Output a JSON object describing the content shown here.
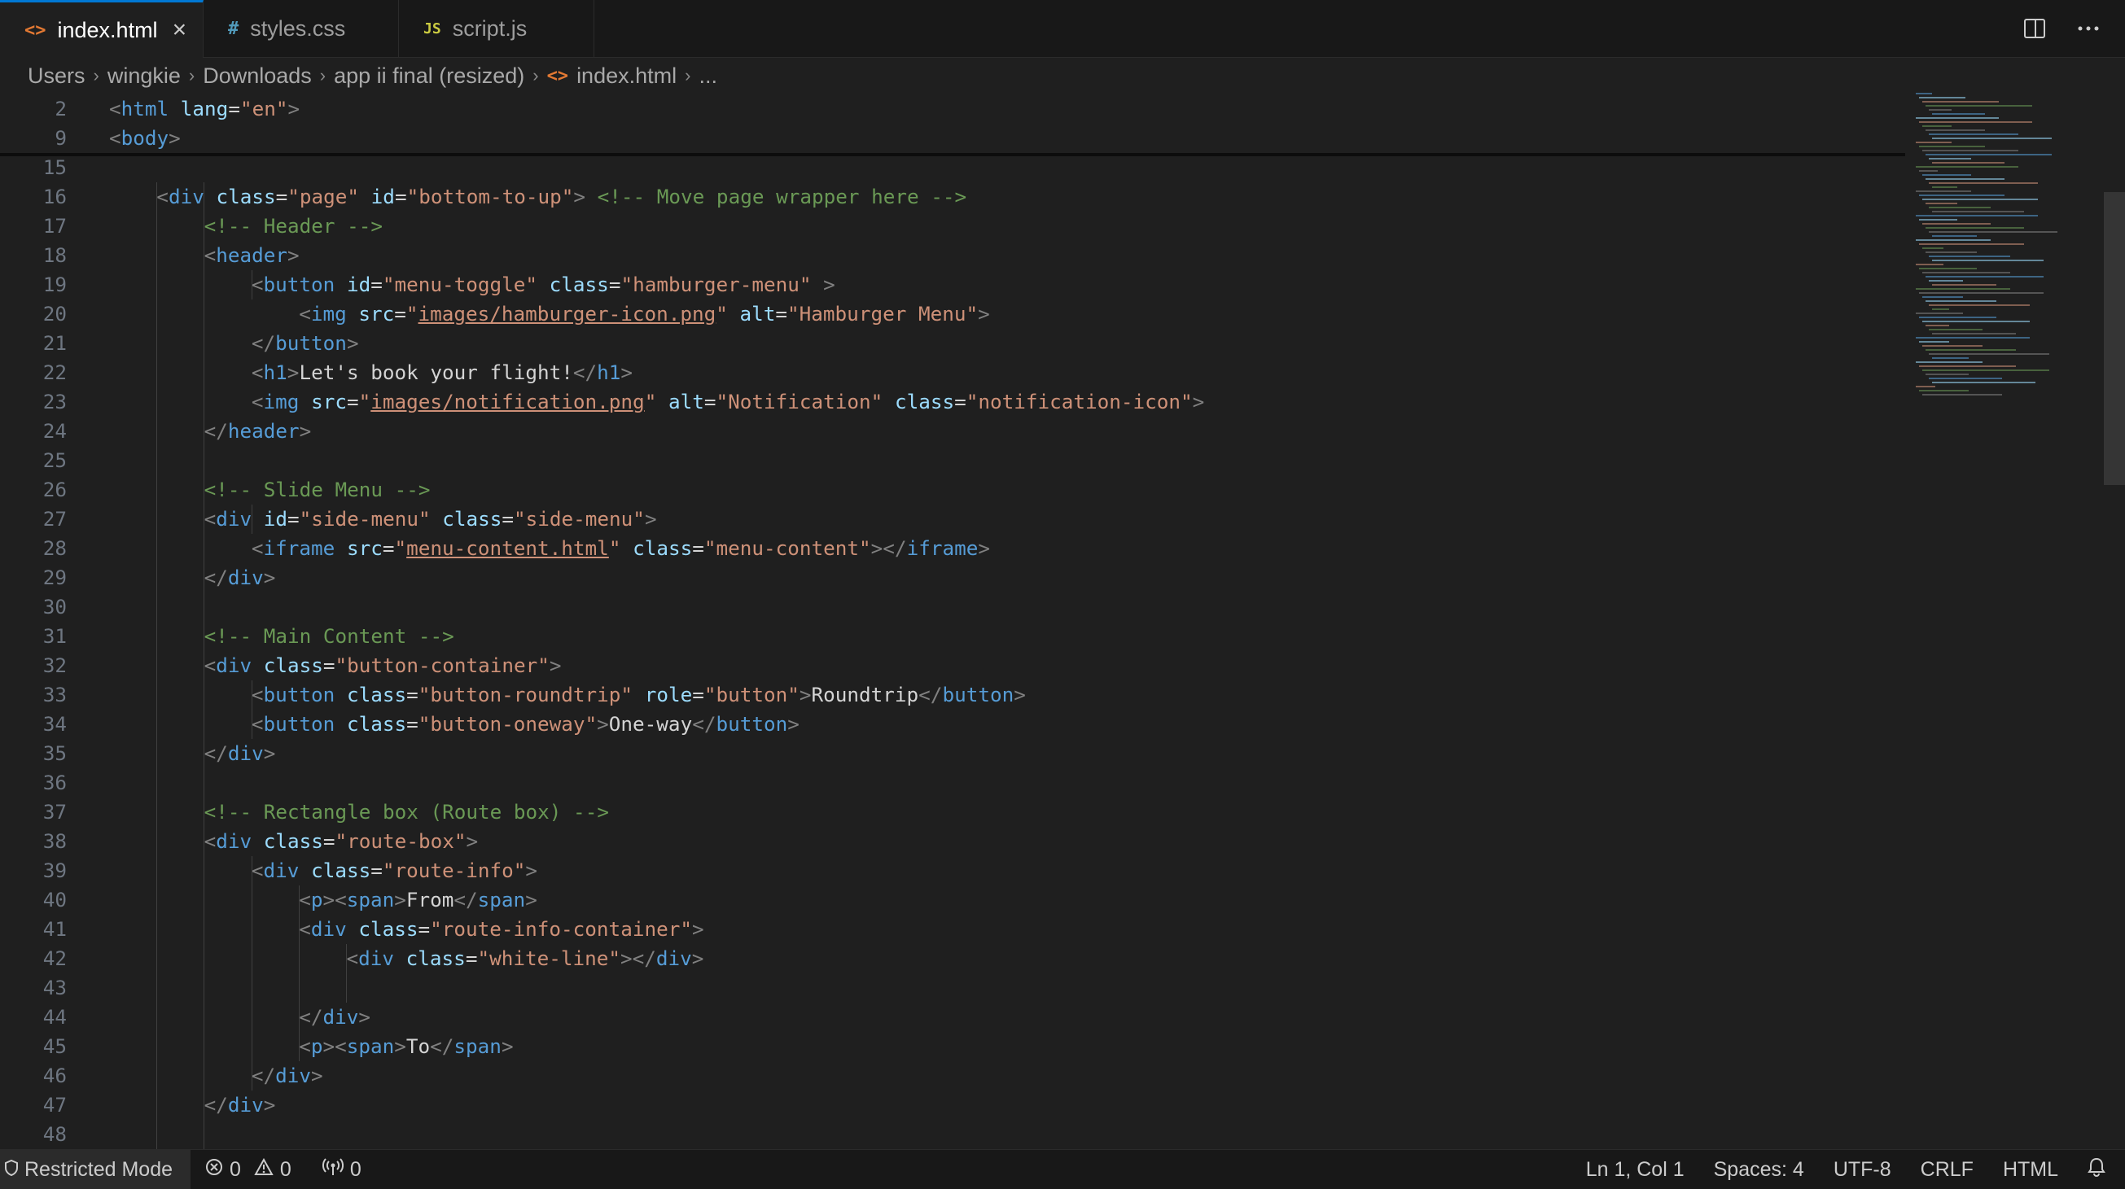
{
  "tabs": [
    {
      "icon": "<>",
      "label": "index.html",
      "active": true,
      "closable": true
    },
    {
      "icon": "#",
      "label": "styles.css",
      "active": false
    },
    {
      "icon": "JS",
      "label": "script.js",
      "active": false
    }
  ],
  "breadcrumb": [
    "Users",
    "wingkie",
    "Downloads",
    "app ii final (resized)",
    "index.html",
    "..."
  ],
  "sticky_lines": [
    {
      "num": "2",
      "tokens": [
        [
          "t",
          "<"
        ],
        [
          "tn",
          "html"
        ],
        [
          "tx",
          " "
        ],
        [
          "an",
          "lang"
        ],
        [
          "tx",
          "="
        ],
        [
          "av",
          "\"en\""
        ],
        [
          "t",
          ">"
        ]
      ]
    },
    {
      "num": "9",
      "tokens": [
        [
          "t",
          "<"
        ],
        [
          "tn",
          "body"
        ],
        [
          "t",
          ">"
        ]
      ]
    }
  ],
  "lines": [
    {
      "num": "15",
      "indent": 0,
      "tokens": []
    },
    {
      "num": "16",
      "indent": 1,
      "tokens": [
        [
          "t",
          "<"
        ],
        [
          "tn",
          "div"
        ],
        [
          "tx",
          " "
        ],
        [
          "an",
          "class"
        ],
        [
          "tx",
          "="
        ],
        [
          "av",
          "\"page\""
        ],
        [
          "tx",
          " "
        ],
        [
          "an",
          "id"
        ],
        [
          "tx",
          "="
        ],
        [
          "av",
          "\"bottom-to-up\""
        ],
        [
          "t",
          ">"
        ],
        [
          "tx",
          " "
        ],
        [
          "cm",
          "<!-- Move page wrapper here -->"
        ]
      ]
    },
    {
      "num": "17",
      "indent": 2,
      "tokens": [
        [
          "cm",
          "<!-- Header -->"
        ]
      ]
    },
    {
      "num": "18",
      "indent": 2,
      "tokens": [
        [
          "t",
          "<"
        ],
        [
          "tn",
          "header"
        ],
        [
          "t",
          ">"
        ]
      ]
    },
    {
      "num": "19",
      "indent": 3,
      "tokens": [
        [
          "t",
          "<"
        ],
        [
          "tn",
          "button"
        ],
        [
          "tx",
          " "
        ],
        [
          "an",
          "id"
        ],
        [
          "tx",
          "="
        ],
        [
          "av",
          "\"menu-toggle\""
        ],
        [
          "tx",
          " "
        ],
        [
          "an",
          "class"
        ],
        [
          "tx",
          "="
        ],
        [
          "av",
          "\"hamburger-menu\""
        ],
        [
          "tx",
          " "
        ],
        [
          "t",
          ">"
        ]
      ]
    },
    {
      "num": "20",
      "indent": 4,
      "tokens": [
        [
          "t",
          "<"
        ],
        [
          "tn",
          "img"
        ],
        [
          "tx",
          " "
        ],
        [
          "an",
          "src"
        ],
        [
          "tx",
          "="
        ],
        [
          "av",
          "\""
        ],
        [
          "avl",
          "images/hamburger-icon.png"
        ],
        [
          "av",
          "\""
        ],
        [
          "tx",
          " "
        ],
        [
          "an",
          "alt"
        ],
        [
          "tx",
          "="
        ],
        [
          "av",
          "\"Hamburger Menu\""
        ],
        [
          "t",
          ">"
        ]
      ]
    },
    {
      "num": "21",
      "indent": 3,
      "tokens": [
        [
          "t",
          "</"
        ],
        [
          "tn",
          "button"
        ],
        [
          "t",
          ">"
        ]
      ]
    },
    {
      "num": "22",
      "indent": 3,
      "tokens": [
        [
          "t",
          "<"
        ],
        [
          "tn",
          "h1"
        ],
        [
          "t",
          ">"
        ],
        [
          "tx",
          "Let's book your flight!"
        ],
        [
          "t",
          "</"
        ],
        [
          "tn",
          "h1"
        ],
        [
          "t",
          ">"
        ]
      ]
    },
    {
      "num": "23",
      "indent": 3,
      "tokens": [
        [
          "t",
          "<"
        ],
        [
          "tn",
          "img"
        ],
        [
          "tx",
          " "
        ],
        [
          "an",
          "src"
        ],
        [
          "tx",
          "="
        ],
        [
          "av",
          "\""
        ],
        [
          "avl",
          "images/notification.png"
        ],
        [
          "av",
          "\""
        ],
        [
          "tx",
          " "
        ],
        [
          "an",
          "alt"
        ],
        [
          "tx",
          "="
        ],
        [
          "av",
          "\"Notification\""
        ],
        [
          "tx",
          " "
        ],
        [
          "an",
          "class"
        ],
        [
          "tx",
          "="
        ],
        [
          "av",
          "\"notification-icon\""
        ],
        [
          "t",
          ">"
        ]
      ]
    },
    {
      "num": "24",
      "indent": 2,
      "tokens": [
        [
          "t",
          "</"
        ],
        [
          "tn",
          "header"
        ],
        [
          "t",
          ">"
        ]
      ]
    },
    {
      "num": "25",
      "indent": 0,
      "tokens": []
    },
    {
      "num": "26",
      "indent": 2,
      "tokens": [
        [
          "cm",
          "<!-- Slide Menu -->"
        ]
      ]
    },
    {
      "num": "27",
      "indent": 2,
      "tokens": [
        [
          "t",
          "<"
        ],
        [
          "tn",
          "div"
        ],
        [
          "tx",
          " "
        ],
        [
          "an",
          "id"
        ],
        [
          "tx",
          "="
        ],
        [
          "av",
          "\"side-menu\""
        ],
        [
          "tx",
          " "
        ],
        [
          "an",
          "class"
        ],
        [
          "tx",
          "="
        ],
        [
          "av",
          "\"side-menu\""
        ],
        [
          "t",
          ">"
        ]
      ]
    },
    {
      "num": "28",
      "indent": 3,
      "tokens": [
        [
          "t",
          "<"
        ],
        [
          "tn",
          "iframe"
        ],
        [
          "tx",
          " "
        ],
        [
          "an",
          "src"
        ],
        [
          "tx",
          "="
        ],
        [
          "av",
          "\""
        ],
        [
          "avl",
          "menu-content.html"
        ],
        [
          "av",
          "\""
        ],
        [
          "tx",
          " "
        ],
        [
          "an",
          "class"
        ],
        [
          "tx",
          "="
        ],
        [
          "av",
          "\"menu-content\""
        ],
        [
          "t",
          "></"
        ],
        [
          "tn",
          "iframe"
        ],
        [
          "t",
          ">"
        ]
      ]
    },
    {
      "num": "29",
      "indent": 2,
      "tokens": [
        [
          "t",
          "</"
        ],
        [
          "tn",
          "div"
        ],
        [
          "t",
          ">"
        ]
      ]
    },
    {
      "num": "30",
      "indent": 0,
      "tokens": []
    },
    {
      "num": "31",
      "indent": 2,
      "tokens": [
        [
          "cm",
          "<!-- Main Content -->"
        ]
      ]
    },
    {
      "num": "32",
      "indent": 2,
      "tokens": [
        [
          "t",
          "<"
        ],
        [
          "tn",
          "div"
        ],
        [
          "tx",
          " "
        ],
        [
          "an",
          "class"
        ],
        [
          "tx",
          "="
        ],
        [
          "av",
          "\"button-container\""
        ],
        [
          "t",
          ">"
        ]
      ]
    },
    {
      "num": "33",
      "indent": 3,
      "tokens": [
        [
          "t",
          "<"
        ],
        [
          "tn",
          "button"
        ],
        [
          "tx",
          " "
        ],
        [
          "an",
          "class"
        ],
        [
          "tx",
          "="
        ],
        [
          "av",
          "\"button-roundtrip\""
        ],
        [
          "tx",
          " "
        ],
        [
          "an",
          "role"
        ],
        [
          "tx",
          "="
        ],
        [
          "av",
          "\"button\""
        ],
        [
          "t",
          ">"
        ],
        [
          "tx",
          "Roundtrip"
        ],
        [
          "t",
          "</"
        ],
        [
          "tn",
          "button"
        ],
        [
          "t",
          ">"
        ]
      ]
    },
    {
      "num": "34",
      "indent": 3,
      "tokens": [
        [
          "t",
          "<"
        ],
        [
          "tn",
          "button"
        ],
        [
          "tx",
          " "
        ],
        [
          "an",
          "class"
        ],
        [
          "tx",
          "="
        ],
        [
          "av",
          "\"button-oneway\""
        ],
        [
          "t",
          ">"
        ],
        [
          "tx",
          "One-way"
        ],
        [
          "t",
          "</"
        ],
        [
          "tn",
          "button"
        ],
        [
          "t",
          ">"
        ]
      ]
    },
    {
      "num": "35",
      "indent": 2,
      "tokens": [
        [
          "t",
          "</"
        ],
        [
          "tn",
          "div"
        ],
        [
          "t",
          ">"
        ]
      ]
    },
    {
      "num": "36",
      "indent": 0,
      "tokens": []
    },
    {
      "num": "37",
      "indent": 2,
      "tokens": [
        [
          "cm",
          "<!-- Rectangle box (Route box) -->"
        ]
      ]
    },
    {
      "num": "38",
      "indent": 2,
      "tokens": [
        [
          "t",
          "<"
        ],
        [
          "tn",
          "div"
        ],
        [
          "tx",
          " "
        ],
        [
          "an",
          "class"
        ],
        [
          "tx",
          "="
        ],
        [
          "av",
          "\"route-box\""
        ],
        [
          "t",
          ">"
        ]
      ]
    },
    {
      "num": "39",
      "indent": 3,
      "tokens": [
        [
          "t",
          "<"
        ],
        [
          "tn",
          "div"
        ],
        [
          "tx",
          " "
        ],
        [
          "an",
          "class"
        ],
        [
          "tx",
          "="
        ],
        [
          "av",
          "\"route-info\""
        ],
        [
          "t",
          ">"
        ]
      ]
    },
    {
      "num": "40",
      "indent": 4,
      "tokens": [
        [
          "t",
          "<"
        ],
        [
          "tn",
          "p"
        ],
        [
          "t",
          "><"
        ],
        [
          "tn",
          "span"
        ],
        [
          "t",
          ">"
        ],
        [
          "tx",
          "From"
        ],
        [
          "t",
          "</"
        ],
        [
          "tn",
          "span"
        ],
        [
          "t",
          ">"
        ]
      ]
    },
    {
      "num": "41",
      "indent": 4,
      "tokens": [
        [
          "t",
          "<"
        ],
        [
          "tn",
          "div"
        ],
        [
          "tx",
          " "
        ],
        [
          "an",
          "class"
        ],
        [
          "tx",
          "="
        ],
        [
          "av",
          "\"route-info-container\""
        ],
        [
          "t",
          ">"
        ]
      ]
    },
    {
      "num": "42",
      "indent": 5,
      "tokens": [
        [
          "t",
          "<"
        ],
        [
          "tn",
          "div"
        ],
        [
          "tx",
          " "
        ],
        [
          "an",
          "class"
        ],
        [
          "tx",
          "="
        ],
        [
          "av",
          "\"white-line\""
        ],
        [
          "t",
          "></"
        ],
        [
          "tn",
          "div"
        ],
        [
          "t",
          ">"
        ]
      ]
    },
    {
      "num": "43",
      "indent": 0,
      "tokens": []
    },
    {
      "num": "44",
      "indent": 4,
      "tokens": [
        [
          "t",
          "</"
        ],
        [
          "tn",
          "div"
        ],
        [
          "t",
          ">"
        ]
      ]
    },
    {
      "num": "45",
      "indent": 4,
      "tokens": [
        [
          "t",
          "<"
        ],
        [
          "tn",
          "p"
        ],
        [
          "t",
          "><"
        ],
        [
          "tn",
          "span"
        ],
        [
          "t",
          ">"
        ],
        [
          "tx",
          "To"
        ],
        [
          "t",
          "</"
        ],
        [
          "tn",
          "span"
        ],
        [
          "t",
          ">"
        ]
      ]
    },
    {
      "num": "46",
      "indent": 3,
      "tokens": [
        [
          "t",
          "</"
        ],
        [
          "tn",
          "div"
        ],
        [
          "t",
          ">"
        ]
      ]
    },
    {
      "num": "47",
      "indent": 2,
      "tokens": [
        [
          "t",
          "</"
        ],
        [
          "tn",
          "div"
        ],
        [
          "t",
          ">"
        ]
      ]
    },
    {
      "num": "48",
      "indent": 0,
      "tokens": []
    }
  ],
  "status": {
    "restricted": "Restricted Mode",
    "errors": "0",
    "warnings": "0",
    "ports": "0",
    "position": "Ln 1, Col 1",
    "spaces": "Spaces: 4",
    "encoding": "UTF-8",
    "eol": "CRLF",
    "language": "HTML"
  },
  "colors": {
    "background": "#1f1f1f",
    "tag": "#569cd6",
    "attribute": "#9cdcfe",
    "string": "#ce9178",
    "comment": "#6a9955",
    "html_icon": "#e37933",
    "js_icon": "#cbcb41",
    "css_icon": "#519aba"
  }
}
